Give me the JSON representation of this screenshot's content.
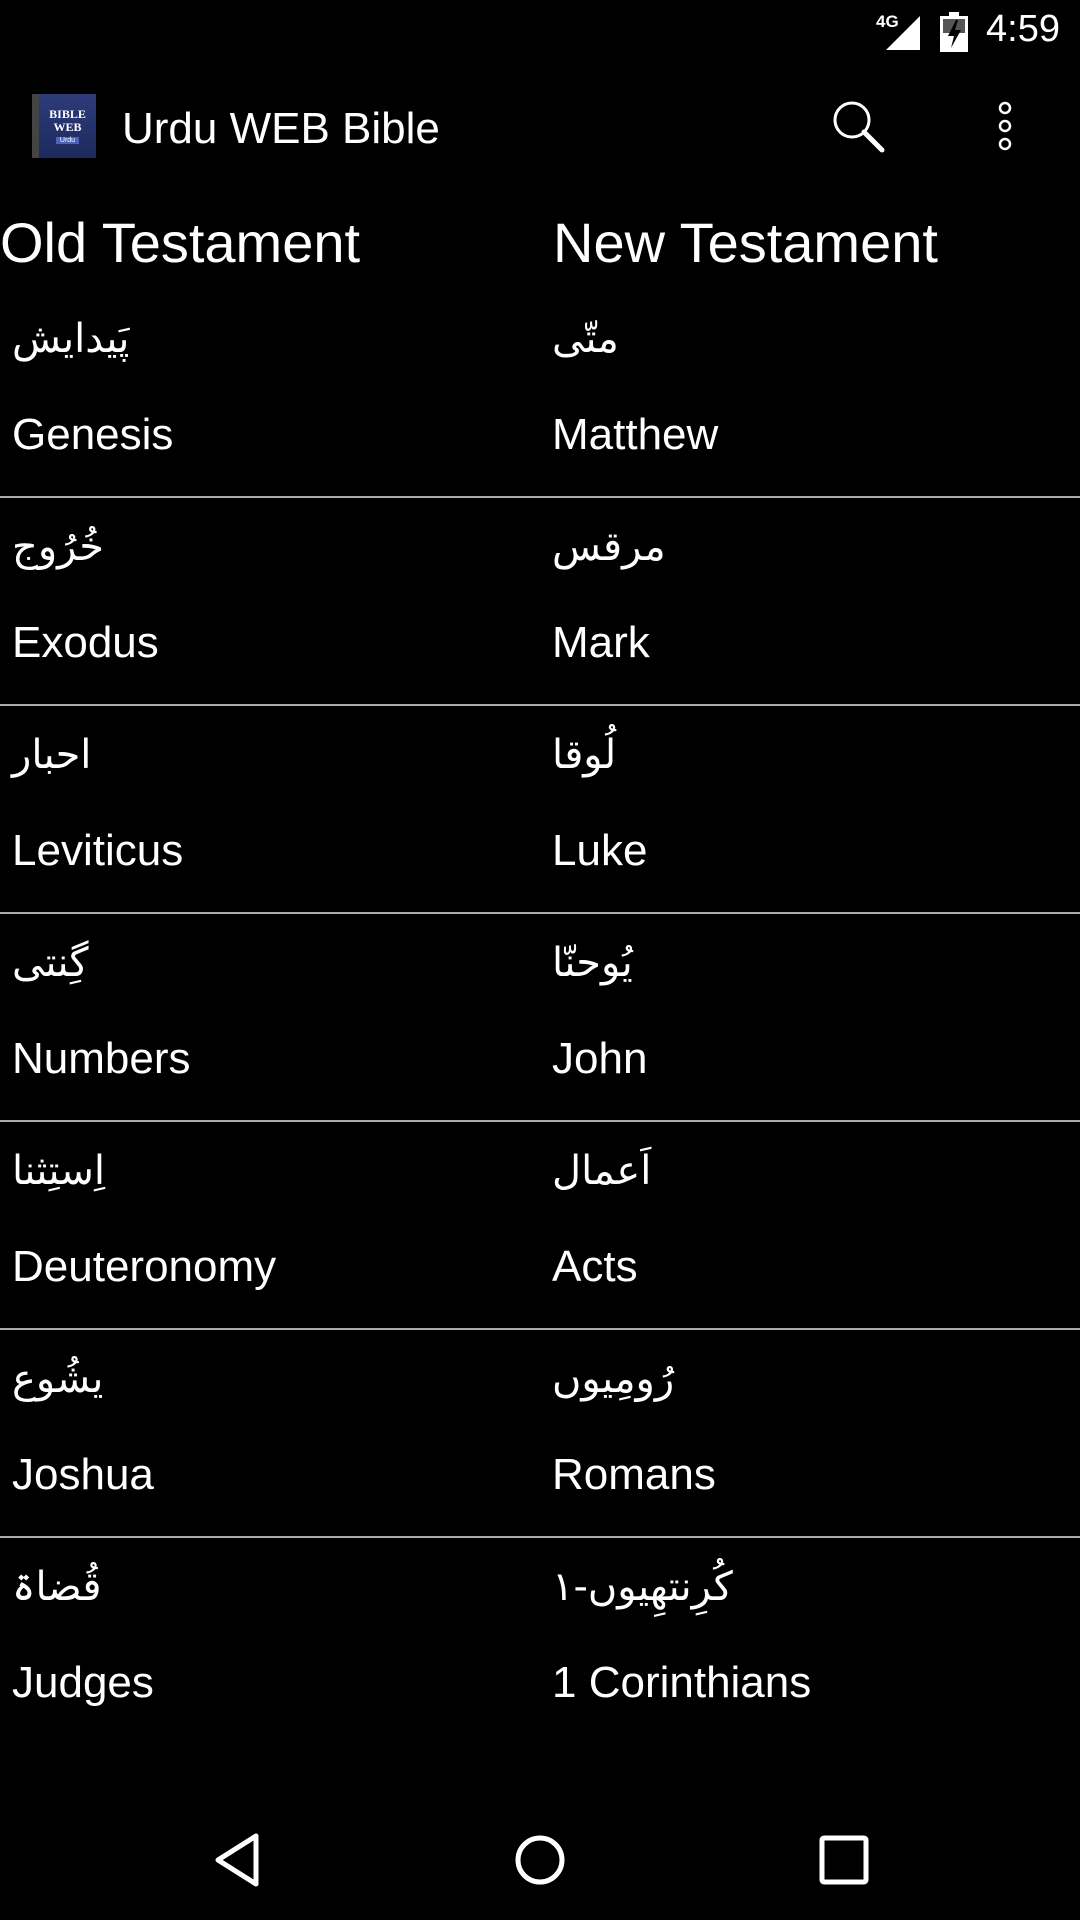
{
  "status_bar": {
    "network": "4G",
    "time": "4:59"
  },
  "app_bar": {
    "title": "Urdu WEB Bible",
    "logo_line1": "BIBLE",
    "logo_line2": "WEB",
    "logo_line3": "Urdu",
    "icons": [
      "search-icon",
      "overflow-menu-icon"
    ]
  },
  "columns": {
    "old_testament": "Old Testament",
    "new_testament": "New Testament"
  },
  "rows": [
    {
      "ot_urdu": "پَیدایش",
      "ot_en": "Genesis",
      "nt_urdu": "متّی",
      "nt_en": "Matthew"
    },
    {
      "ot_urdu": "خُرُوج",
      "ot_en": "Exodus",
      "nt_urdu": "مرقس",
      "nt_en": "Mark"
    },
    {
      "ot_urdu": "احبار",
      "ot_en": "Leviticus",
      "nt_urdu": "لُوقا",
      "nt_en": "Luke"
    },
    {
      "ot_urdu": "گِنتی",
      "ot_en": "Numbers",
      "nt_urdu": "یُوحنّا",
      "nt_en": "John"
    },
    {
      "ot_urdu": "اِستِثنا",
      "ot_en": "Deuteronomy",
      "nt_urdu": "اَعمال",
      "nt_en": "Acts"
    },
    {
      "ot_urdu": "یشُوع",
      "ot_en": "Joshua",
      "nt_urdu": "رُومِیوں",
      "nt_en": "Romans"
    },
    {
      "ot_urdu": "قُضاۃ",
      "ot_en": "Judges",
      "nt_urdu": "کُرِنتھِیوں-١",
      "nt_en": "1 Corinthians"
    }
  ],
  "nav_bar": {
    "icons": [
      "back-icon",
      "home-icon",
      "recents-icon"
    ]
  },
  "colors": {
    "background": "#000000",
    "text": "#ffffff",
    "divider": "#aaaaaa",
    "logo_blue": "#2d3c7a"
  }
}
